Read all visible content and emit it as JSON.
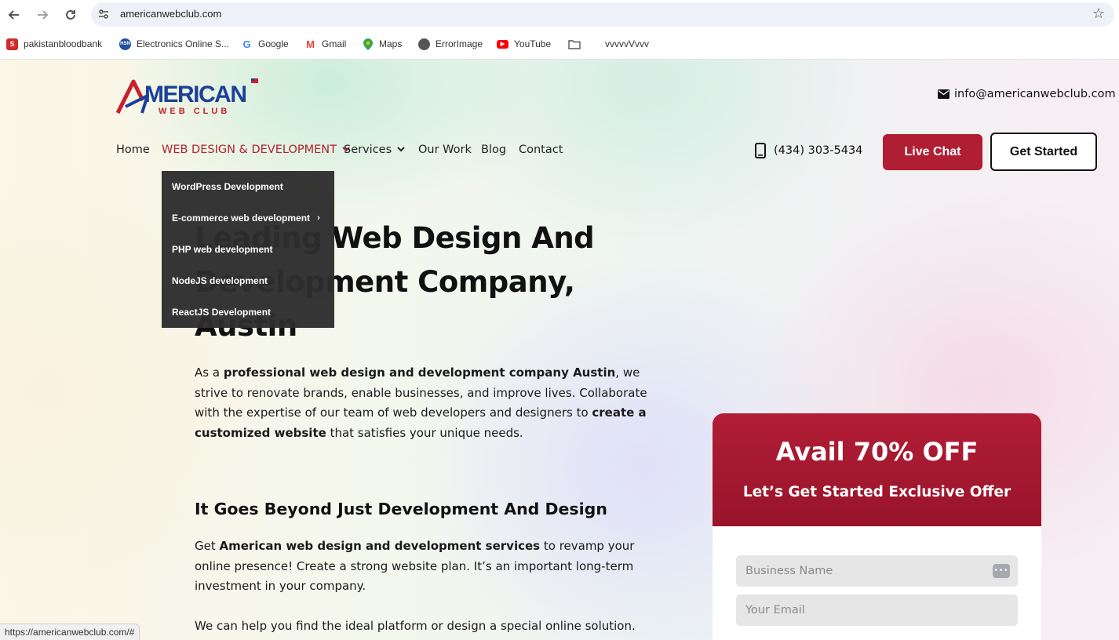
{
  "browser": {
    "url": "americanwebclub.com",
    "bookmarks": [
      {
        "label": "pakistanbloodbank",
        "icon": "pakistanbloodbank-icon",
        "color": "#d42a2a"
      },
      {
        "label": "Electronics Online S...",
        "icon": "hsn-icon",
        "color": "#1f4fa0"
      },
      {
        "label": "Google",
        "icon": "google-icon",
        "color": "#4285f4"
      },
      {
        "label": "Gmail",
        "icon": "gmail-icon",
        "color": "#ea4335"
      },
      {
        "label": "Maps",
        "icon": "maps-icon",
        "color": "#34a853"
      },
      {
        "label": "ErrorImage",
        "icon": "globe-icon",
        "color": "#555555"
      },
      {
        "label": "YouTube",
        "icon": "youtube-icon",
        "color": "#ff0000"
      },
      {
        "label": "",
        "icon": "folder-icon",
        "color": "#555555"
      },
      {
        "label": "vvvvvVvvv",
        "icon": "",
        "color": ""
      }
    ],
    "status_url": "https://americanwebclub.com/#"
  },
  "site": {
    "logo_text": "MERICAN",
    "logo_tagline": "WEB CLUB",
    "email": "info@americanwebclub.com",
    "phone": "(434) 303-5434",
    "nav": {
      "home": "Home",
      "web_design": "WEB DESIGN & DEVELOPMENT",
      "services": "Services",
      "our_work": "Our Work",
      "blog": "Blog",
      "contact": "Contact"
    },
    "buttons": {
      "live_chat": "Live Chat",
      "get_started": "Get Started"
    },
    "dropdown": [
      "WordPress Development",
      "E-commerce web development",
      "PHP web development",
      "NodeJS development",
      "ReactJS Development"
    ],
    "brand_red": "#b01e33"
  },
  "hero": {
    "title_line1": "Leading Web Design And",
    "title_line2": "Development Company,",
    "title_line3": "Austin",
    "p1": {
      "t1": "As a ",
      "b1": "professional web design and development company Austin",
      "t2": ", we strive to renovate brands, enable businesses, and improve lives. Collaborate with the expertise of our team of web developers and designers to ",
      "b2": "create a customized website",
      "t3": " that satisfies your unique needs."
    },
    "subheading": "It Goes Beyond Just Development And Design",
    "p2": {
      "t1": "Get ",
      "b1": "American web design and development services",
      "t2": " to revamp your online presence! Create a strong website plan. It’s an important long-term investment in your company."
    },
    "p3": "We can help you find the ideal platform or design a special online solution."
  },
  "offer": {
    "title": "Avail 70% OFF",
    "subtitle": "Let’s Get Started Exclusive Offer",
    "business_placeholder": "Business Name",
    "email_placeholder": "Your Email"
  }
}
